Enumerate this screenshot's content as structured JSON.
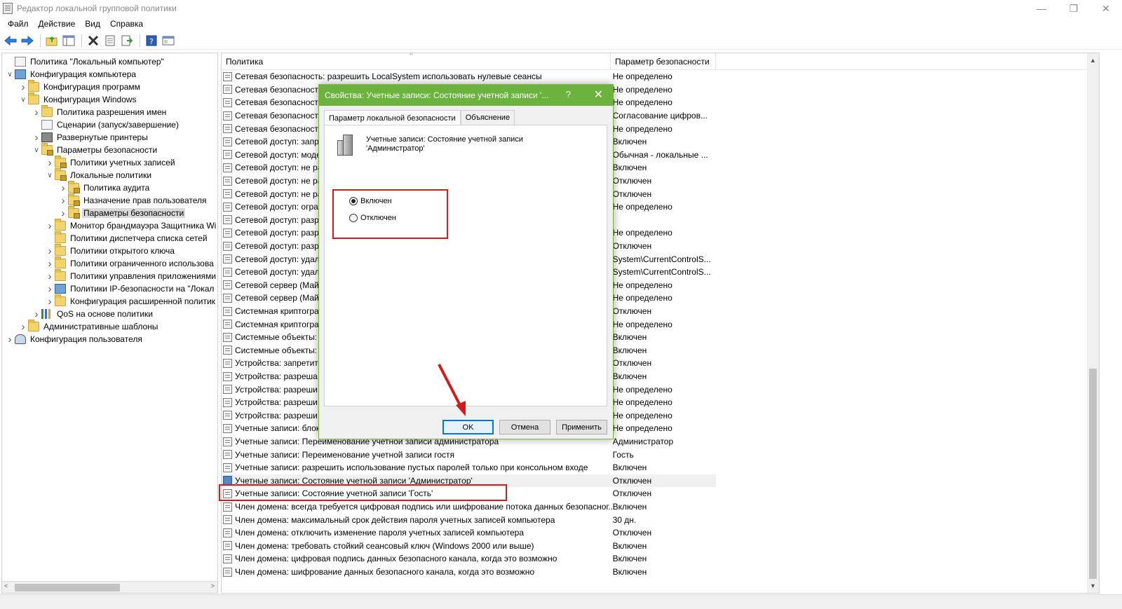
{
  "window": {
    "title": "Редактор локальной групповой политики",
    "minimize": "—",
    "restore": "❐",
    "close": "✕"
  },
  "menu": [
    "Файл",
    "Действие",
    "Вид",
    "Справка"
  ],
  "tree": {
    "items": [
      {
        "label": "Политика \"Локальный компьютер\"",
        "level": 0,
        "icon": "doc-icon",
        "arrow": ""
      },
      {
        "label": "Конфигурация компьютера",
        "level": 0,
        "icon": "computer-icon",
        "arrow": "v"
      },
      {
        "label": "Конфигурация программ",
        "level": 1,
        "icon": "folder-icon",
        "arrow": ">"
      },
      {
        "label": "Конфигурация Windows",
        "level": 1,
        "icon": "folder-icon",
        "arrow": "v"
      },
      {
        "label": "Политика разрешения имен",
        "level": 2,
        "icon": "folder-icon",
        "arrow": ">"
      },
      {
        "label": "Сценарии (запуск/завершение)",
        "level": 2,
        "icon": "doc-icon",
        "arrow": ""
      },
      {
        "label": "Развернутые принтеры",
        "level": 2,
        "icon": "printer-icon",
        "arrow": ">"
      },
      {
        "label": "Параметры безопасности",
        "level": 2,
        "icon": "lock-folder-icon",
        "arrow": "v"
      },
      {
        "label": "Политики учетных записей",
        "level": 3,
        "icon": "lock-folder-icon",
        "arrow": ">"
      },
      {
        "label": "Локальные политики",
        "level": 3,
        "icon": "lock-folder-icon",
        "arrow": "v"
      },
      {
        "label": "Политика аудита",
        "level": 4,
        "icon": "lock-folder-icon",
        "arrow": ">"
      },
      {
        "label": "Назначение прав пользователя",
        "level": 4,
        "icon": "lock-folder-icon",
        "arrow": ">"
      },
      {
        "label": "Параметры безопасности",
        "level": 4,
        "icon": "lock-folder-icon",
        "arrow": ">",
        "selected": true
      },
      {
        "label": "Монитор брандмауэра Защитника Wi",
        "level": 3,
        "icon": "folder-icon",
        "arrow": ">"
      },
      {
        "label": "Политики диспетчера списка сетей",
        "level": 3,
        "icon": "folder-icon",
        "arrow": ""
      },
      {
        "label": "Политики открытого ключа",
        "level": 3,
        "icon": "folder-icon",
        "arrow": ">"
      },
      {
        "label": "Политики ограниченного использова",
        "level": 3,
        "icon": "folder-icon",
        "arrow": ">"
      },
      {
        "label": "Политики управления приложениями",
        "level": 3,
        "icon": "folder-icon",
        "arrow": ">"
      },
      {
        "label": "Политики IP-безопасности на \"Локал",
        "level": 3,
        "icon": "computer-icon",
        "arrow": ">"
      },
      {
        "label": "Конфигурация расширенной политик",
        "level": 3,
        "icon": "folder-icon",
        "arrow": ">"
      },
      {
        "label": "QoS на основе политики",
        "level": 2,
        "icon": "bars-icon",
        "arrow": ">"
      },
      {
        "label": "Административные шаблоны",
        "level": 1,
        "icon": "folder-icon",
        "arrow": ">"
      },
      {
        "label": "Конфигурация пользователя",
        "level": 0,
        "icon": "user-icon",
        "arrow": ">"
      }
    ]
  },
  "list": {
    "col_policy": "Политика",
    "col_setting": "Параметр безопасности",
    "rows": [
      {
        "name": "Сетевая безопасность: разрешить LocalSystem использовать нулевые сеансы",
        "value": "Не определено"
      },
      {
        "name": "Сетевая безопасность",
        "value": "Не определено"
      },
      {
        "name": "Сетевая безопасность",
        "value": "Не определено"
      },
      {
        "name": "Сетевая безопасность",
        "value": "Согласование цифров..."
      },
      {
        "name": "Сетевая безопасность",
        "value": "Не определено"
      },
      {
        "name": "Сетевой доступ: запр",
        "value": "Включен"
      },
      {
        "name": "Сетевой доступ: моде",
        "value": "Обычная - локальные ..."
      },
      {
        "name": "Сетевой доступ: не ра",
        "value": "Включен"
      },
      {
        "name": "Сетевой доступ: не ра",
        "value": "Отключен"
      },
      {
        "name": "Сетевой доступ: не ра",
        "value": "Отключен"
      },
      {
        "name": "Сетевой доступ: огра",
        "value": "Не определено"
      },
      {
        "name": "Сетевой доступ: разр",
        "value": ""
      },
      {
        "name": "Сетевой доступ: разр",
        "value": "Не определено"
      },
      {
        "name": "Сетевой доступ: разр",
        "value": "Отключен"
      },
      {
        "name": "Сетевой доступ: удал",
        "value": "System\\CurrentControlS..."
      },
      {
        "name": "Сетевой доступ: удал",
        "value": "System\\CurrentControlS..."
      },
      {
        "name": "Сетевой сервер (Май",
        "value": "Не определено"
      },
      {
        "name": "Сетевой сервер (Май",
        "value": "Не определено"
      },
      {
        "name": "Системная криптогра",
        "value": "Отключен"
      },
      {
        "name": "Системная криптогра",
        "value": "Не определено"
      },
      {
        "name": "Системные объекты:",
        "value": "Включен"
      },
      {
        "name": "Системные объекты:",
        "value": "Включен"
      },
      {
        "name": "Устройства: запретит",
        "value": "Отключен"
      },
      {
        "name": "Устройства: разреша",
        "value": "Включен"
      },
      {
        "name": "Устройства: разреши",
        "value": "Не определено"
      },
      {
        "name": "Устройства: разреши",
        "value": "Не определено"
      },
      {
        "name": "Устройства: разреши",
        "value": "Не определено"
      },
      {
        "name": "Учетные записи: блок",
        "value": "Не определено"
      },
      {
        "name": "Учетные записи: Переименование учетной записи администратора",
        "value": "Администратор"
      },
      {
        "name": "Учетные записи: Переименование учетной записи гостя",
        "value": "Гость"
      },
      {
        "name": "Учетные записи: разрешить использование пустых паролей только при консольном входе",
        "value": "Включен"
      },
      {
        "name": "Учетные записи: Состояние учетной записи 'Администратор'",
        "value": "Отключен",
        "selected": true
      },
      {
        "name": "Учетные записи: Состояние учетной записи 'Гость'",
        "value": "Отключен"
      },
      {
        "name": "Член домена: всегда требуется цифровая подпись или шифрование потока данных безопасног...",
        "value": "Включен"
      },
      {
        "name": "Член домена: максимальный срок действия пароля учетных записей компьютера",
        "value": "30 дн."
      },
      {
        "name": "Член домена: отключить изменение пароля учетных записей компьютера",
        "value": "Отключен"
      },
      {
        "name": "Член домена: требовать стойкий сеансовый ключ (Windows 2000 или выше)",
        "value": "Включен"
      },
      {
        "name": "Член домена: цифровая подпись данных безопасного канала, когда это возможно",
        "value": "Включен"
      },
      {
        "name": "Член домена: шифрование данных безопасного канала, когда это возможно",
        "value": "Включен"
      }
    ]
  },
  "dialog": {
    "title": "Свойства: Учетные записи: Состояние учетной записи '...",
    "help": "?",
    "close": "✕",
    "tab_local": "Параметр локальной безопасности",
    "tab_explain": "Объяснение",
    "description": "Учетные записи: Состояние учетной записи 'Администратор'",
    "radio_enabled": "Включен",
    "radio_disabled": "Отключен",
    "selected": "Включен",
    "ok": "OK",
    "cancel": "Отмена",
    "apply": "Применить"
  },
  "colors": {
    "dialog_title": "#6cb23e",
    "highlight_red": "#d21c1c",
    "default_button_border": "#0078d7"
  }
}
